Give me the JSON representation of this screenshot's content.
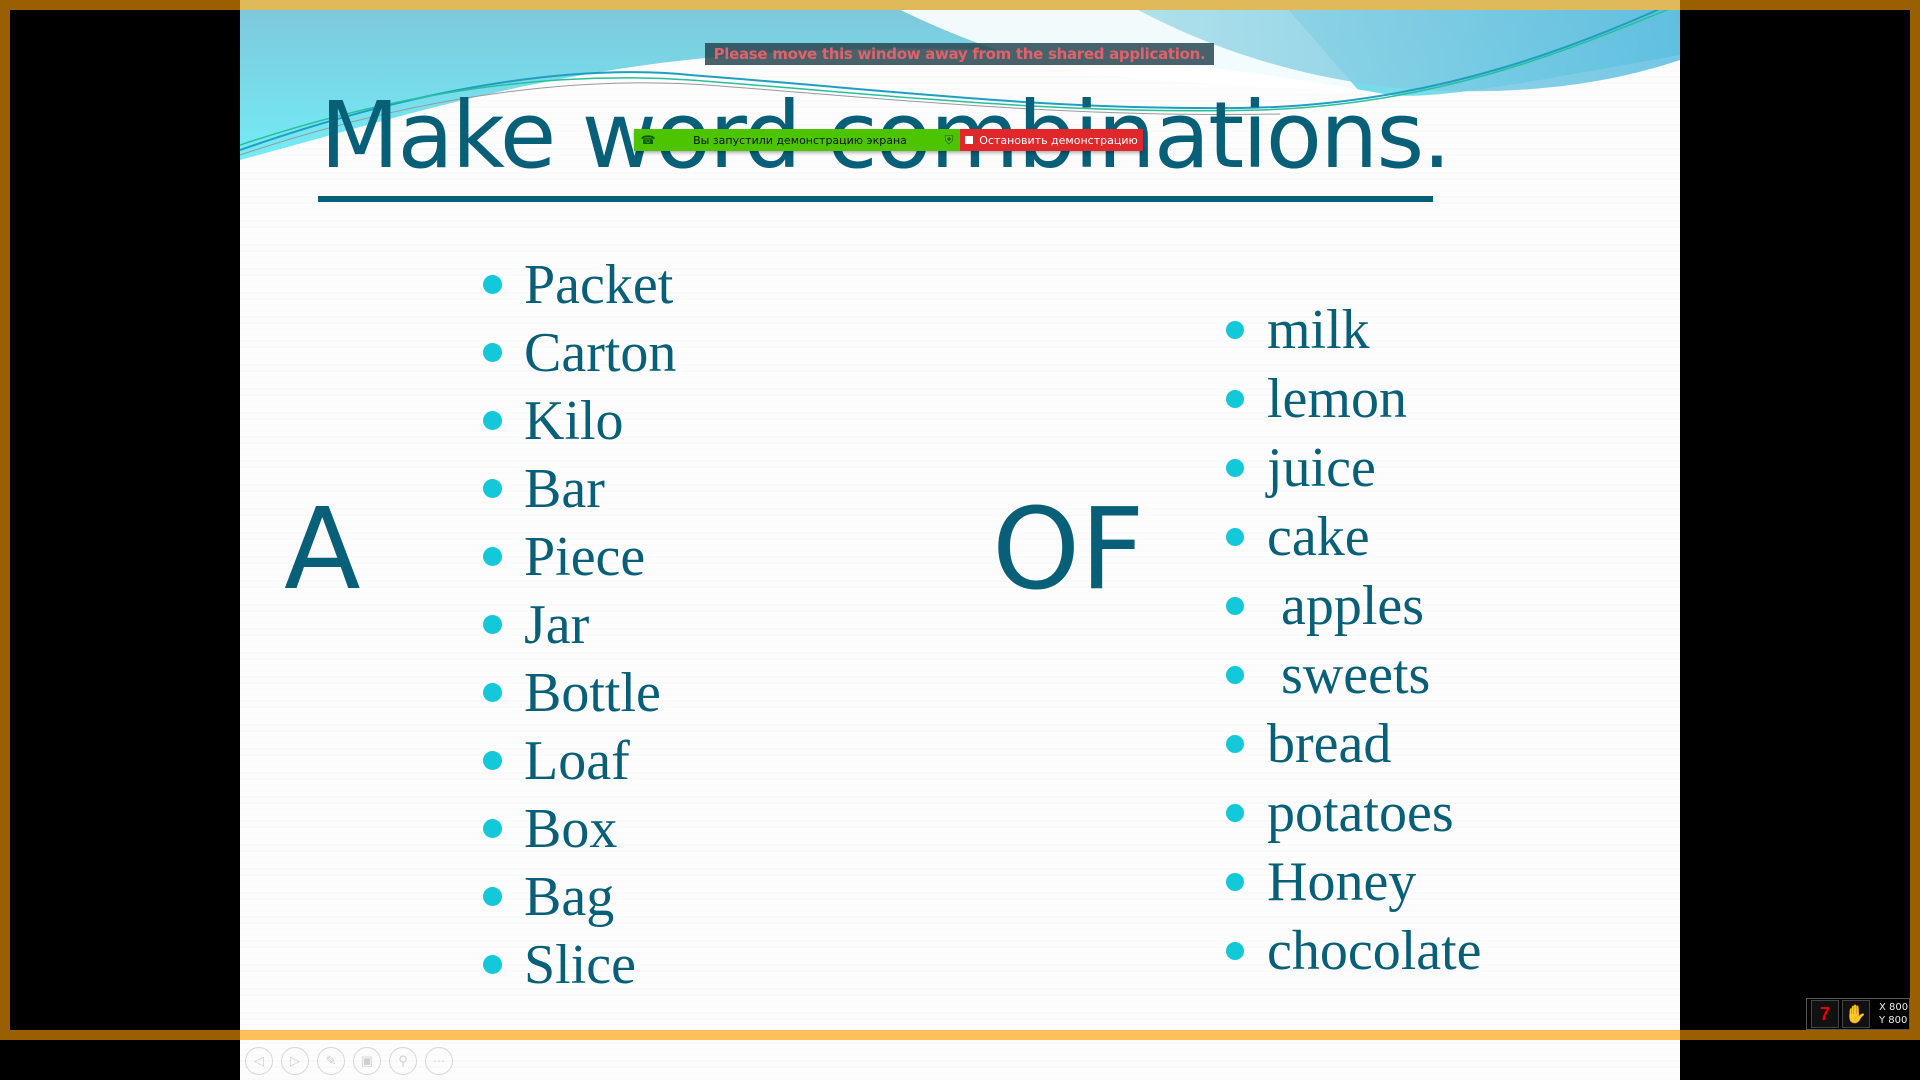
{
  "slide": {
    "title": "Make word combinations.",
    "letter_left": "A",
    "letter_middle": "OF",
    "left_list": [
      "Packet",
      "Carton",
      "Kilo",
      "Bar",
      "Piece",
      "Jar",
      "Bottle",
      "Loaf",
      "Box",
      "Bag",
      "Slice"
    ],
    "right_list": [
      "milk",
      "lemon",
      "juice",
      "cake",
      " apples",
      " sweets",
      "bread",
      "potatoes",
      "Honey",
      "chocolate"
    ]
  },
  "overlay": {
    "banner_text": "Please move this window away from the shared application.",
    "share_status": "Вы запустили демонстрацию экрана",
    "stop_share_label": "Остановить демонстрацию"
  },
  "slideshow_tools": [
    {
      "name": "previous-slide",
      "icon": "◁"
    },
    {
      "name": "next-slide",
      "icon": "▷"
    },
    {
      "name": "pen",
      "icon": "✎"
    },
    {
      "name": "see-all-slides",
      "icon": "▣"
    },
    {
      "name": "zoom",
      "icon": "⚲"
    },
    {
      "name": "more-options",
      "icon": "···"
    }
  ],
  "indicator": {
    "x_label": "X 800",
    "y_label": "Y 800"
  },
  "colors": {
    "title": "#075f78",
    "bullet": "#13c9d9",
    "frame": "#9a5f00",
    "share_green": "#4cc500",
    "share_red": "#e0282b",
    "banner_text": "#e2616b"
  }
}
